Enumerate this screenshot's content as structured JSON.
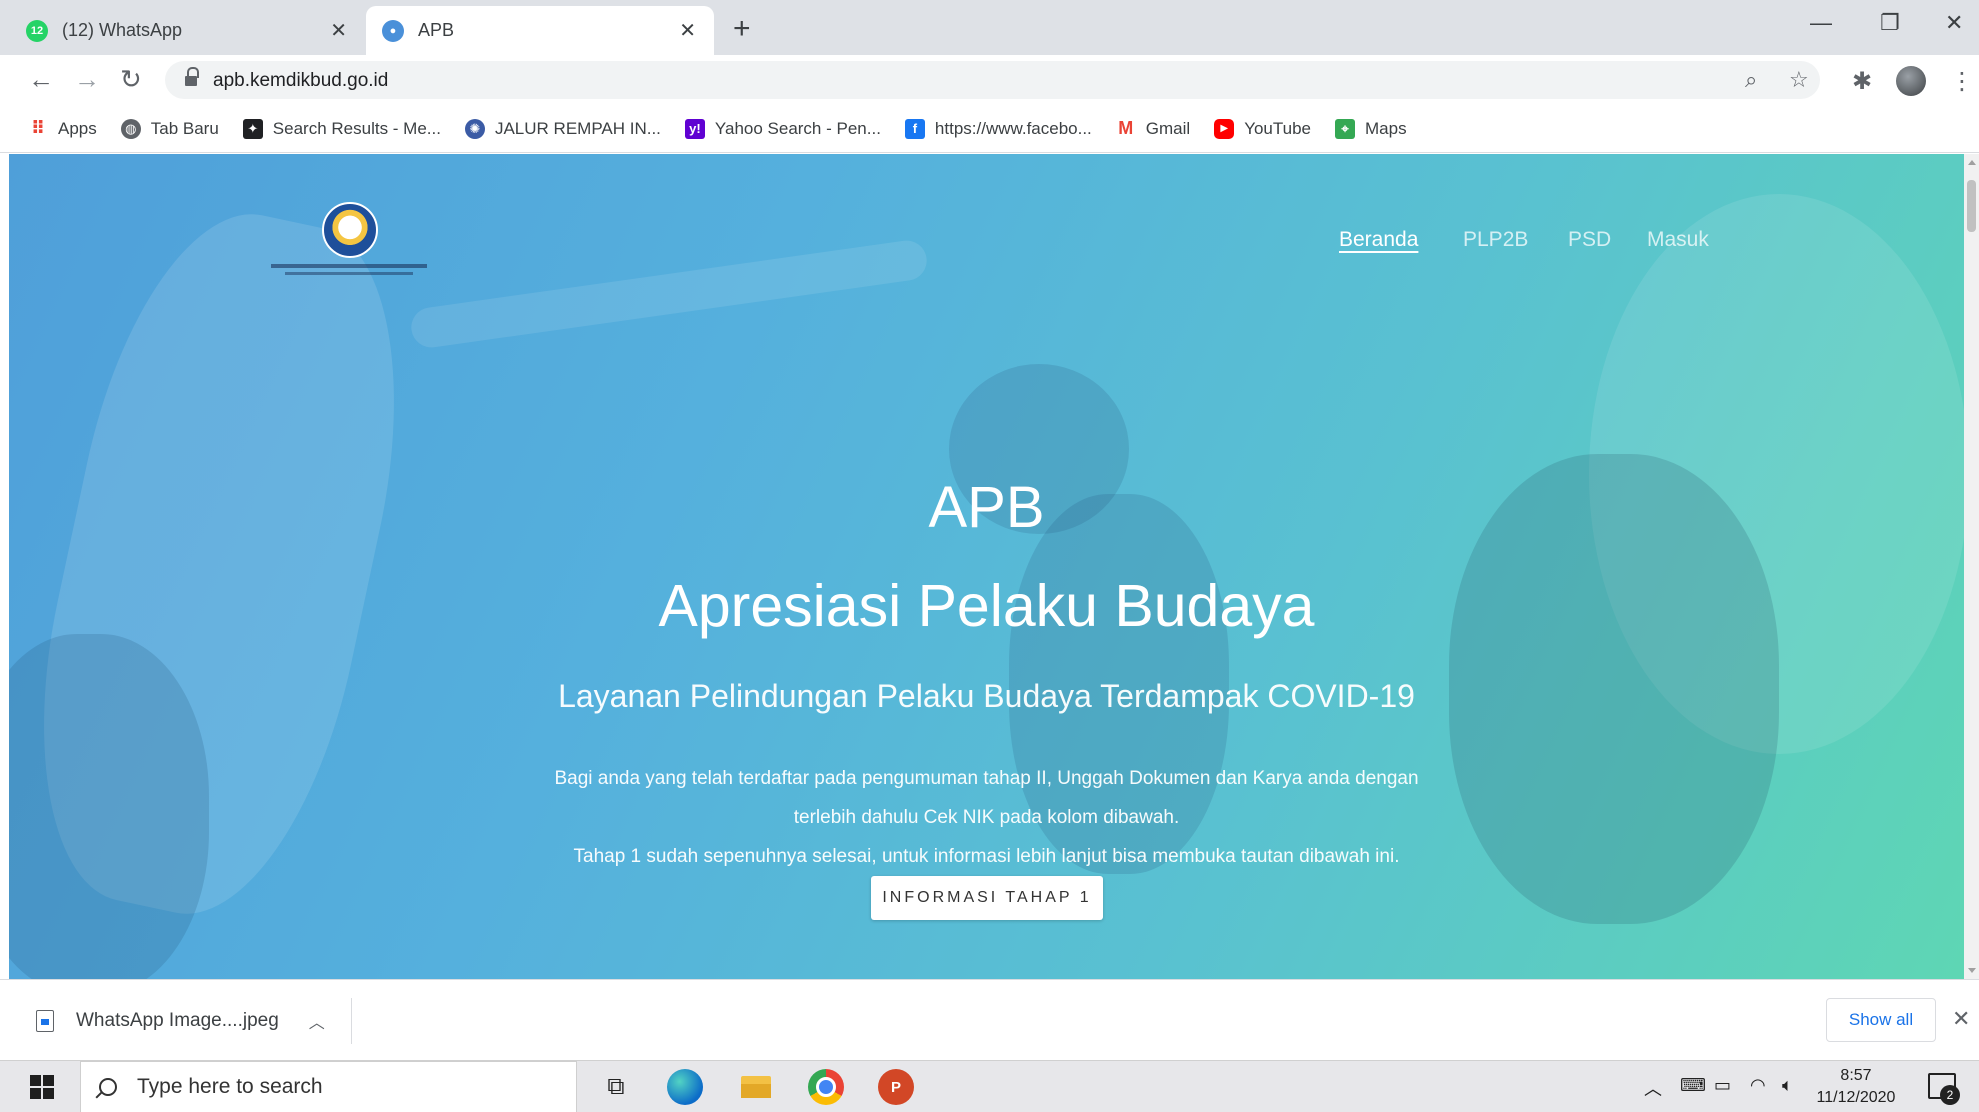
{
  "browser": {
    "tabs": [
      {
        "title": "(12) WhatsApp",
        "badge": "12",
        "favicon": "whatsapp-icon",
        "active": false
      },
      {
        "title": "APB",
        "favicon": "kemdikbud-globe-icon",
        "active": true
      }
    ],
    "url": "apb.kemdikbud.go.id",
    "bookmarks": [
      {
        "label": "Apps",
        "icon": "apps-grid-icon"
      },
      {
        "label": "Tab Baru",
        "icon": "globe-icon"
      },
      {
        "label": "Search Results - Me...",
        "icon": "search-results-icon"
      },
      {
        "label": "JALUR REMPAH IN...",
        "icon": "jalur-rempah-icon"
      },
      {
        "label": "Yahoo Search - Pen...",
        "icon": "yahoo-icon"
      },
      {
        "label": "https://www.facebo...",
        "icon": "facebook-icon"
      },
      {
        "label": "Gmail",
        "icon": "gmail-icon"
      },
      {
        "label": "YouTube",
        "icon": "youtube-icon"
      },
      {
        "label": "Maps",
        "icon": "maps-icon"
      }
    ]
  },
  "page": {
    "nav": [
      "Beranda",
      "PLP2B",
      "PSD",
      "Masuk"
    ],
    "active_nav": "Beranda",
    "title": "APB",
    "subtitle": "Apresiasi Pelaku Budaya",
    "tagline": "Layanan Pelindungan Pelaku Budaya Terdampak COVID-19",
    "paragraph_line1": "Bagi anda yang telah terdaftar pada pengumuman tahap II, Unggah Dokumen dan Karya anda dengan",
    "paragraph_line2": "terlebih dahulu Cek NIK pada kolom dibawah.",
    "paragraph_line3": "Tahap 1 sudah sepenuhnya selesai, untuk informasi lebih lanjut bisa membuka tautan dibawah ini.",
    "button_label": "INFORMASI TAHAP 1"
  },
  "downloads": {
    "file_name": "WhatsApp Image....jpeg",
    "show_all": "Show all"
  },
  "taskbar": {
    "search_placeholder": "Type here to search",
    "time": "8:57",
    "date": "11/12/2020",
    "notification_count": "2"
  },
  "colors": {
    "hero_gradient_start": "#4f9fd9",
    "hero_gradient_end": "#5ed6b4",
    "link_blue": "#1a73e8"
  }
}
